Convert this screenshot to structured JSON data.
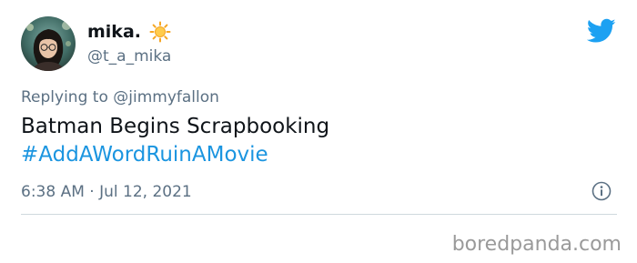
{
  "author": {
    "display_name": "mika.",
    "handle": "@t_a_mika",
    "avatar_icon": "profile-photo",
    "badge_icon": "sun-emoji"
  },
  "tweet": {
    "reply_prefix": "Replying to",
    "reply_to": "@jimmyfallon",
    "text": "Batman Begins Scrapbooking",
    "hashtag": "#AddAWordRuinAMovie",
    "timestamp": "6:38 AM · Jul 12, 2021"
  },
  "icons": {
    "brand": "twitter-bird-icon",
    "info": "info-icon"
  },
  "watermark": "boredpanda.com",
  "colors": {
    "brand_blue": "#1da1f2",
    "link_blue": "#1b95e0",
    "secondary_text": "#5b7083",
    "primary_text": "#0f1419",
    "divider": "#cfd9de",
    "watermark": "#9a9a9a"
  }
}
